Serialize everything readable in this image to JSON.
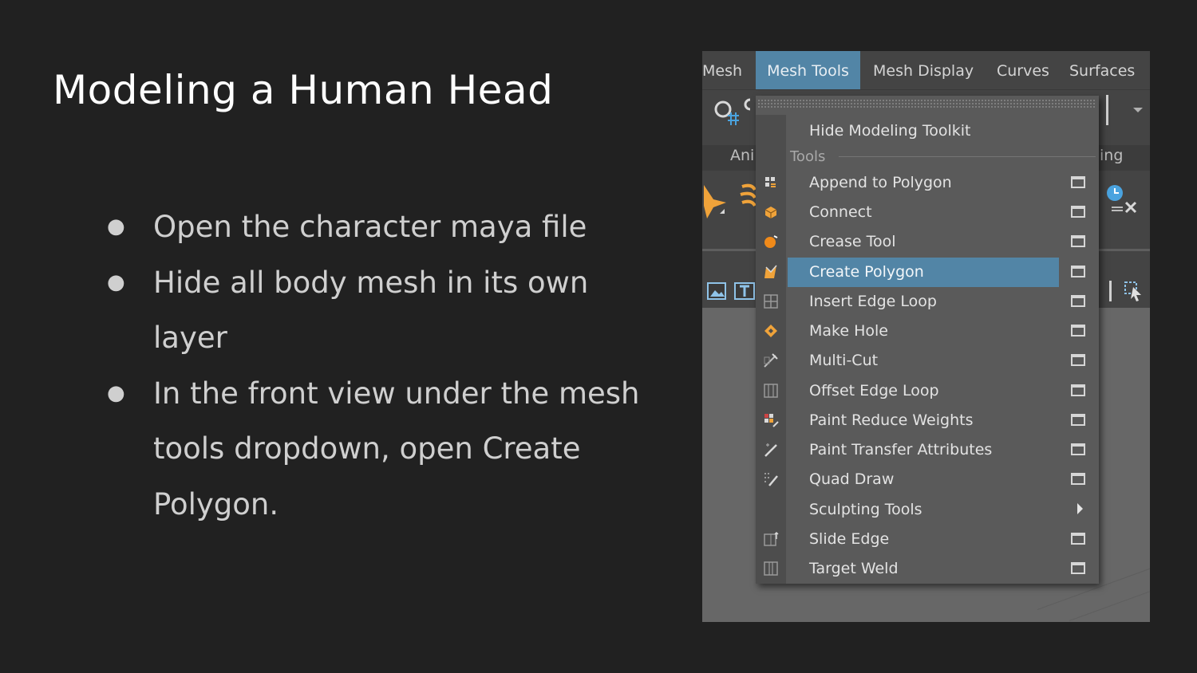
{
  "slide": {
    "title": "Modeling a Human Head",
    "bullets": [
      {
        "lines": [
          "Open the character maya file"
        ]
      },
      {
        "lines": [
          "Hide all body mesh in its own layer"
        ]
      },
      {
        "lines": [
          "In the front view under the mesh",
          "tools dropdown, open Create",
          "Polygon."
        ]
      }
    ]
  },
  "maya": {
    "menubar": [
      {
        "label": "Mesh",
        "active": false
      },
      {
        "label": "Mesh Tools",
        "active": true
      },
      {
        "label": "Mesh Display",
        "active": false
      },
      {
        "label": "Curves",
        "active": false
      },
      {
        "label": "Surfaces",
        "active": false
      }
    ],
    "shelf_tabs": {
      "left": "Ani",
      "right": "ing"
    },
    "dropdown": {
      "top_item": "Hide Modeling Toolkit",
      "section": "Tools",
      "items": [
        {
          "label": "Append to Polygon",
          "icon": "append-polygon-icon",
          "has_options": true,
          "selected": false
        },
        {
          "label": "Connect",
          "icon": "connect-icon",
          "has_options": true,
          "selected": false
        },
        {
          "label": "Crease Tool",
          "icon": "crease-icon",
          "has_options": true,
          "selected": false
        },
        {
          "label": "Create Polygon",
          "icon": "create-polygon-icon",
          "has_options": true,
          "selected": true
        },
        {
          "label": "Insert Edge Loop",
          "icon": "insert-edge-loop-icon",
          "has_options": true,
          "selected": false
        },
        {
          "label": "Make Hole",
          "icon": "make-hole-icon",
          "has_options": true,
          "selected": false
        },
        {
          "label": "Multi-Cut",
          "icon": "multi-cut-icon",
          "has_options": true,
          "selected": false
        },
        {
          "label": "Offset Edge Loop",
          "icon": "offset-edge-loop-icon",
          "has_options": true,
          "selected": false
        },
        {
          "label": "Paint Reduce Weights",
          "icon": "paint-reduce-weights-icon",
          "has_options": true,
          "selected": false
        },
        {
          "label": "Paint Transfer Attributes",
          "icon": "paint-transfer-icon",
          "has_options": true,
          "selected": false
        },
        {
          "label": "Quad Draw",
          "icon": "quad-draw-icon",
          "has_options": true,
          "selected": false
        },
        {
          "label": "Sculpting Tools",
          "icon": "",
          "has_options": false,
          "submenu": true,
          "selected": false
        },
        {
          "label": "Slide Edge",
          "icon": "slide-edge-icon",
          "has_options": true,
          "selected": false
        },
        {
          "label": "Target Weld",
          "icon": "target-weld-icon",
          "has_options": true,
          "selected": false
        }
      ]
    },
    "colors": {
      "highlight": "#5285a6",
      "menu_bg": "#5a5a5a",
      "accent_orange": "#f0a33a"
    }
  }
}
